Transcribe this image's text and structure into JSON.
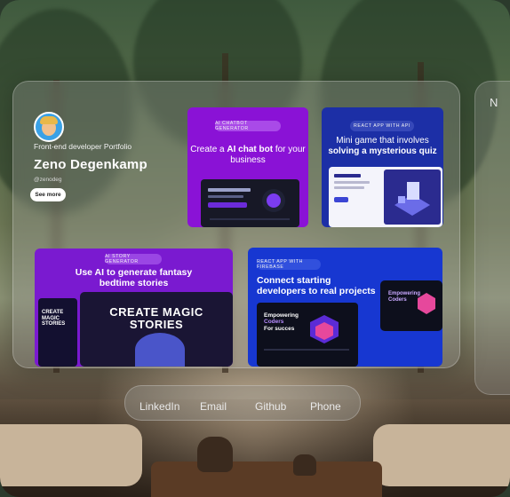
{
  "side_panel": {
    "letter": "N"
  },
  "profile": {
    "subtitle": "Front-end developer Portfolio",
    "name": "Zeno Degenkamp",
    "handle": "@zenodeg",
    "see_more_label": "See more"
  },
  "cards": [
    {
      "tag": "AI CHATBOT GENERATOR",
      "title_pre": "Create a ",
      "title_bold": "AI chat bot",
      "title_post": " for your business"
    },
    {
      "tag": "REACT APP WITH API",
      "title_line1": "Mini game that involves",
      "title_line2": "solving a mysterious quiz"
    },
    {
      "tag": "AI STORY GENERATOR",
      "title": "Use AI to generate fantasy bedtime stories",
      "screen_text": "CREATE MAGIC STORIES"
    },
    {
      "tag": "REACT APP WITH FIREBASE",
      "title": "Connect starting developers to real projects",
      "screen_line1": "Empowering",
      "screen_line2": "Coders",
      "screen_line3": "For succes"
    }
  ],
  "nav": {
    "items": [
      "LinkedIn",
      "Email",
      "Github",
      "Phone"
    ]
  }
}
